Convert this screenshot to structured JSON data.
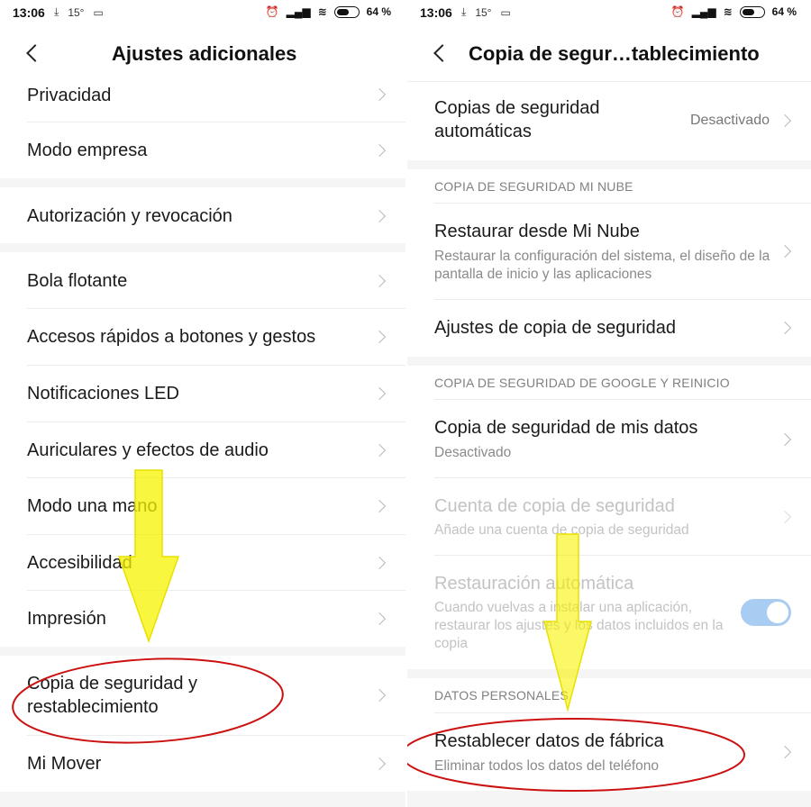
{
  "left": {
    "status": {
      "time": "13:06",
      "temp": "15°",
      "battery": "64 %",
      "battery_level": 0.64
    },
    "title": "Ajustes adicionales",
    "items": [
      {
        "label": "Privacidad"
      },
      {
        "label": "Modo empresa"
      },
      {
        "label": "Autorización y revocación"
      },
      {
        "label": "Bola flotante"
      },
      {
        "label": "Accesos rápidos a botones y gestos"
      },
      {
        "label": "Notificaciones LED"
      },
      {
        "label": "Auriculares y efectos de audio"
      },
      {
        "label": "Modo una mano"
      },
      {
        "label": "Accesibilidad"
      },
      {
        "label": "Impresión"
      },
      {
        "label": "Copia de seguridad y",
        "label2": "restablecimiento"
      },
      {
        "label": "Mi Mover"
      }
    ]
  },
  "right": {
    "status": {
      "time": "13:06",
      "temp": "15°",
      "battery": "64 %",
      "battery_level": 0.64
    },
    "title": "Copia de segur…tablecimiento",
    "auto_backup": {
      "label": "Copias de seguridad",
      "label2": "automáticas",
      "value": "Desactivado"
    },
    "section_mi_cloud": "COPIA DE SEGURIDAD MI NUBE",
    "restore_mi_cloud": {
      "label": "Restaurar desde Mi Nube",
      "sub": "Restaurar la configuración del sistema, el diseño de la pantalla de inicio y las aplicaciones"
    },
    "backup_settings": {
      "label": "Ajustes de copia de seguridad"
    },
    "section_google": "COPIA DE SEGURIDAD DE GOOGLE Y REINICIO",
    "backup_my_data": {
      "label": "Copia de seguridad de mis datos",
      "sub": "Desactivado"
    },
    "backup_account": {
      "label": "Cuenta de copia de seguridad",
      "sub": "Añade una cuenta de copia de seguridad"
    },
    "auto_restore": {
      "label": "Restauración automática",
      "sub": "Cuando vuelvas a instalar una aplicación, restaurar los ajustes y los datos incluidos en la copia",
      "enabled": true
    },
    "section_personal": "DATOS PERSONALES",
    "factory_reset": {
      "label": "Restablecer datos de fábrica",
      "sub": "Eliminar todos los datos del teléfono"
    }
  },
  "colors": {
    "annotation_ellipse": "#cc1111",
    "annotation_arrow": "#f7f300",
    "toggle_on": "#a9ccf2"
  }
}
